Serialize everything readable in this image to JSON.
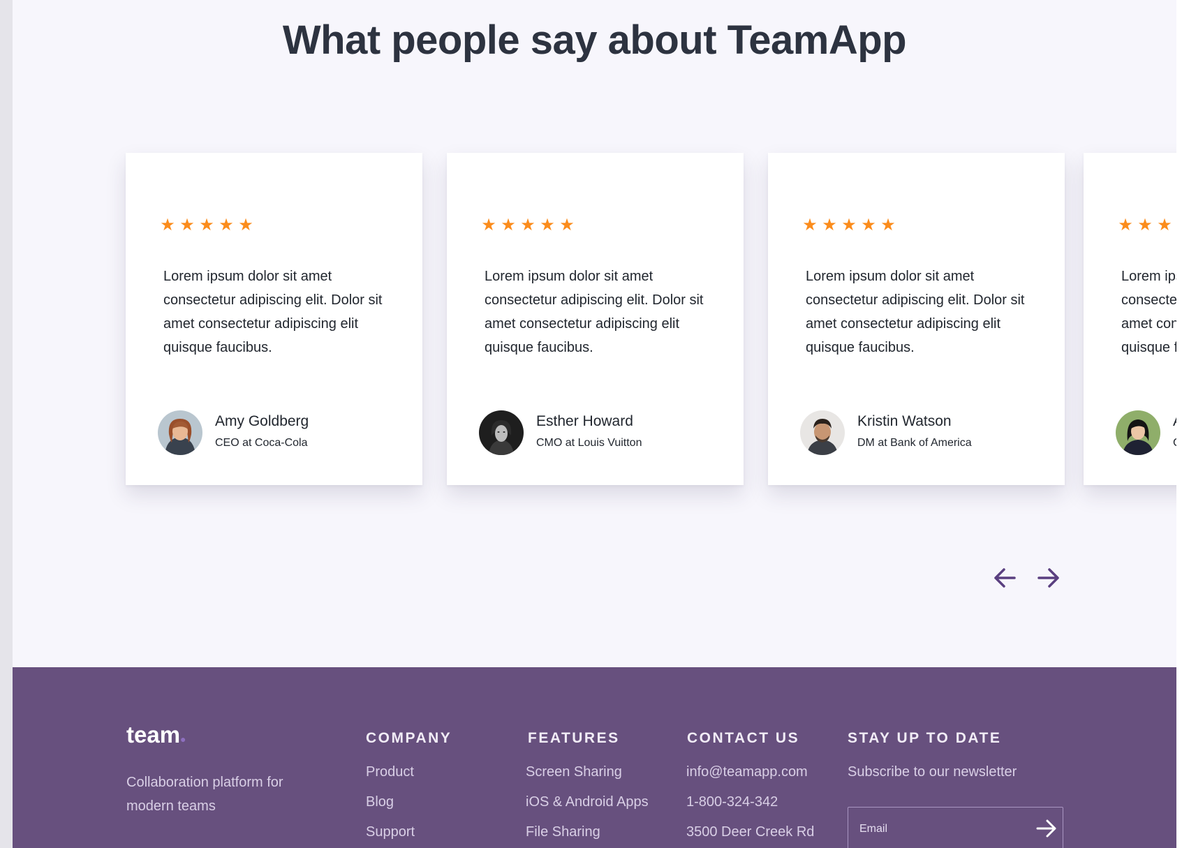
{
  "section": {
    "heading": "What people say about TeamApp"
  },
  "testimonials": [
    {
      "rating": 5,
      "stars": [
        "★",
        "★",
        "★",
        "★",
        "★"
      ],
      "quote": "Lorem ipsum dolor sit amet consectetur adipiscing elit. Dolor sit amet consectetur adipiscing elit quisque faucibus.",
      "name": "Amy Goldberg",
      "role": "CEO at Coca-Cola"
    },
    {
      "rating": 5,
      "stars": [
        "★",
        "★",
        "★",
        "★",
        "★"
      ],
      "quote": "Lorem ipsum dolor sit amet consectetur adipiscing elit. Dolor sit amet consectetur adipiscing elit quisque faucibus.",
      "name": "Esther Howard",
      "role": "CMO at Louis Vuitton"
    },
    {
      "rating": 5,
      "stars": [
        "★",
        "★",
        "★",
        "★",
        "★"
      ],
      "quote": "Lorem ipsum dolor sit amet consectetur adipiscing elit. Dolor sit amet consectetur adipiscing elit quisque faucibus.",
      "name": "Kristin Watson",
      "role": "DM at Bank of America"
    },
    {
      "rating": 5,
      "stars": [
        "★",
        "★",
        "★",
        "★",
        "★"
      ],
      "quote": "Lorem ipsum dolor sit amet consectetur adipiscing elit. Dolor sit amet consectetur adipiscing elit quisque faucibus.",
      "name": "A",
      "role": "C"
    }
  ],
  "carousel": {
    "prev_icon": "arrow-left-icon",
    "next_icon": "arrow-right-icon",
    "accent": "#5a3f80"
  },
  "colors": {
    "star": "#fb8c1c",
    "footer_bg": "#67507e",
    "page_bg": "#f7f6fc"
  },
  "footer": {
    "logo": "team",
    "tagline": "Collaboration platform for modern teams",
    "columns": {
      "company": {
        "title": "COMPANY",
        "items": [
          "Product",
          "Blog",
          "Support"
        ]
      },
      "features": {
        "title": "FEATURES",
        "items": [
          "Screen Sharing",
          "iOS & Android Apps",
          "File Sharing"
        ]
      },
      "contact": {
        "title": "CONTACT US",
        "items": [
          "info@teamapp.com",
          "1-800-324-342",
          "3500 Deer Creek Rd"
        ]
      },
      "newsletter": {
        "title": "STAY UP TO DATE",
        "subtitle": "Subscribe to our newsletter",
        "email_placeholder": "Email",
        "submit_icon": "arrow-right-icon"
      }
    }
  }
}
